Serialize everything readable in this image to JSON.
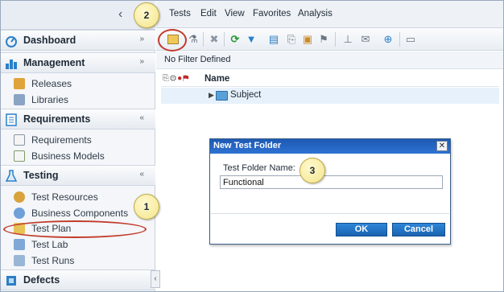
{
  "menubar": {
    "items": [
      "Tests",
      "Edit",
      "View",
      "Favorites",
      "Analysis"
    ]
  },
  "sidebar": {
    "sections": [
      {
        "label": "Dashboard",
        "chevron": "»",
        "icon": "dashboard-gauge-icon",
        "items": []
      },
      {
        "label": "Management",
        "chevron": "»",
        "icon": "management-chart-icon",
        "items": [
          {
            "label": "Releases",
            "icon": "releases-icon"
          },
          {
            "label": "Libraries",
            "icon": "libraries-icon"
          }
        ]
      },
      {
        "label": "Requirements",
        "chevron": "«",
        "icon": "requirements-icon",
        "items": [
          {
            "label": "Requirements",
            "icon": "requirement-doc-icon"
          },
          {
            "label": "Business Models",
            "icon": "business-models-icon"
          }
        ]
      },
      {
        "label": "Testing",
        "chevron": "«",
        "icon": "testing-flask-icon",
        "items": [
          {
            "label": "Test Resources",
            "icon": "test-resources-icon"
          },
          {
            "label": "Business Components",
            "icon": "business-components-icon"
          },
          {
            "label": "Test Plan",
            "icon": "test-plan-icon"
          },
          {
            "label": "Test Lab",
            "icon": "test-lab-icon"
          },
          {
            "label": "Test Runs",
            "icon": "test-runs-icon"
          }
        ]
      },
      {
        "label": "Defects",
        "chevron": "",
        "icon": "defects-icon",
        "items": []
      }
    ]
  },
  "toolbar": {
    "icons": [
      "new-folder-icon",
      "new-test-icon",
      "delete-icon",
      "refresh-icon",
      "filter-icon",
      "copy-to-icon",
      "attach-icon",
      "flag-icon",
      "pin-icon",
      "mail-icon",
      "find-icon",
      "comment-icon"
    ]
  },
  "filter": {
    "text": "No Filter Defined"
  },
  "tree": {
    "column_name": "Name",
    "root": "Subject"
  },
  "dialog": {
    "title": "New Test Folder",
    "close": "✕",
    "field_label": "Test Folder Name:",
    "field_value": "Functional",
    "ok_label": "OK",
    "cancel_label": "Cancel"
  },
  "callouts": {
    "one": "1",
    "two": "2",
    "three": "3"
  },
  "colors": {
    "accent": "#1a63b0",
    "callout_ring": "#c23a2a",
    "callout_fill": "#f3e58a"
  }
}
